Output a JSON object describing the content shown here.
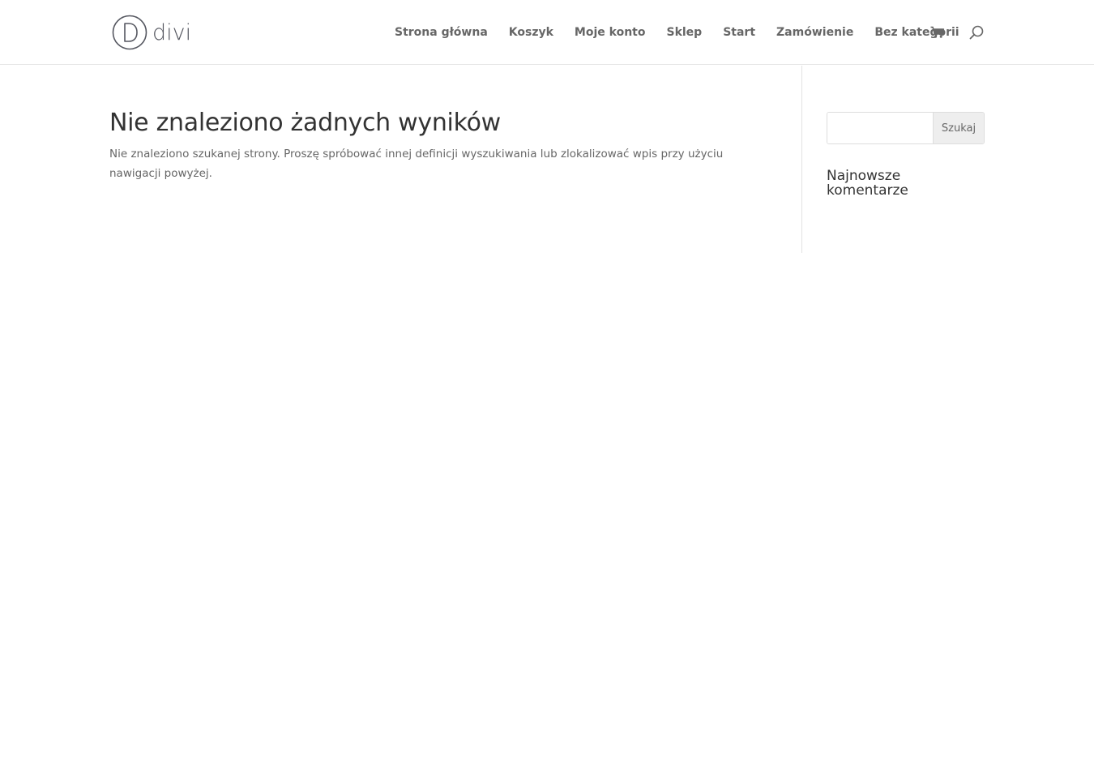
{
  "header": {
    "logo": {
      "text": "divi",
      "letter": "D"
    },
    "nav": [
      {
        "label": "Strona główna"
      },
      {
        "label": "Koszyk"
      },
      {
        "label": "Moje konto"
      },
      {
        "label": "Sklep"
      },
      {
        "label": "Start"
      },
      {
        "label": "Zamówienie"
      },
      {
        "label": "Bez kategorii"
      }
    ],
    "icons": {
      "cart": "cart-icon",
      "search": "search-icon"
    }
  },
  "main": {
    "title": "Nie znaleziono żadnych wyników",
    "text": "Nie znaleziono szukanej strony. Proszę spróbować innej definicji wyszukiwania lub zlokalizować wpis przy użyciu nawigacji powyżej."
  },
  "sidebar": {
    "search": {
      "value": "",
      "placeholder": "",
      "button_label": "Szukaj"
    },
    "widget_title": "Najnowsze komentarze"
  },
  "colors": {
    "text": "#666666",
    "heading": "#333333",
    "border": "#e6e6e6",
    "button_bg": "#eeeeee"
  }
}
